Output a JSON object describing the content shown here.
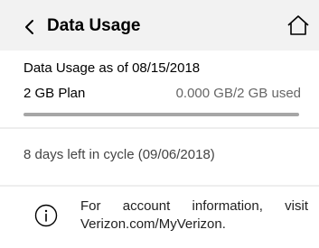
{
  "header": {
    "title": "Data Usage",
    "back_icon": "chevron-left-icon",
    "home_icon": "home-icon",
    "background": "#f2f2f2"
  },
  "usage": {
    "as_of_text": "Data Usage as of 08/15/2018",
    "plan_name": "2 GB Plan",
    "plan_usage": "0.000 GB/2 GB used",
    "used_fraction": 0.0,
    "bar_track_color": "#a6a6a6",
    "bar_fill_color": "#cd040b"
  },
  "cycle": {
    "text": "8 days left in cycle (09/06/2018)"
  },
  "info": {
    "icon": "info-circle-icon",
    "text": "For account information, visit Verizon.com/MyVerizon."
  }
}
